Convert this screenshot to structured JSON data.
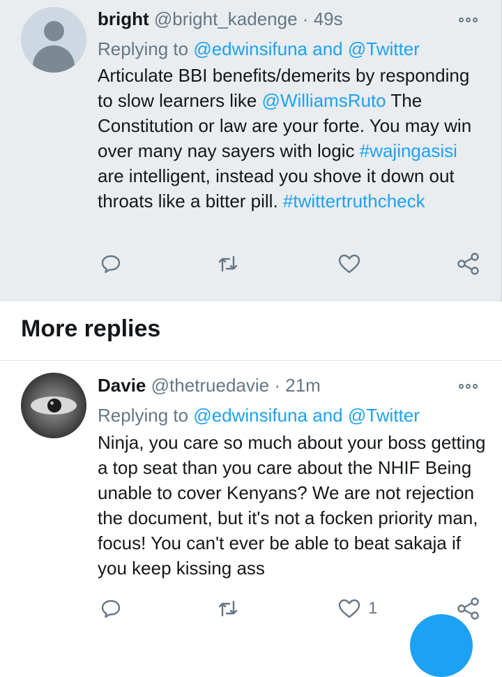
{
  "tweets": [
    {
      "name": "bright",
      "handle": "@bright_kadenge",
      "separator": "·",
      "time": "49s",
      "replying_prefix": "Replying to",
      "replying_user1": "@edwinsifuna",
      "replying_and": "and",
      "replying_user2": "@Twitter",
      "text": {
        "p1": "Articulate BBI benefits/demerits by responding to slow learners like ",
        "mention": "@WilliamsRuto",
        "p2": " The Constitution or law are your forte. You may win over many nay sayers with logic ",
        "hashtag1": "#wajingasisi",
        "p3": " are intelligent, instead you shove it down out throats like a bitter pill. ",
        "hashtag2": "#twittertruthcheck"
      }
    },
    {
      "name": "Davie",
      "handle": "@thetruedavie",
      "separator": "·",
      "time": "21m",
      "replying_prefix": "Replying to",
      "replying_user1": "@edwinsifuna",
      "replying_and": "and",
      "replying_user2": "@Twitter",
      "text": "Ninja, you care so much about your boss getting a top seat than you care about the NHIF Being unable to cover Kenyans? We are not rejection the document, but it's not a focken priority man, focus! You can't ever be able to beat sakaja if you keep kissing ass",
      "like_count": "1"
    }
  ],
  "section": {
    "title": "More replies"
  },
  "icons": {
    "reply": "speech-bubble-icon",
    "retweet": "retweet-arrows-icon",
    "like": "heart-icon",
    "share": "share-nodes-icon",
    "more": "three-dots-icon"
  },
  "colors": {
    "accent": "#1da1f2",
    "secondary": "#657786",
    "highlight_bg": "#e9edf0"
  }
}
